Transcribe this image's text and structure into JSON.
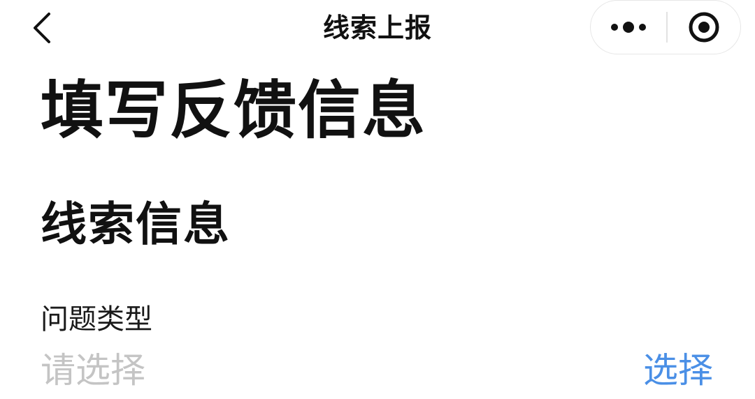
{
  "navbar": {
    "title": "线索上报",
    "back_icon": "chevron-left-icon",
    "more_icon": "more-dots-icon",
    "close_icon": "target-circle-icon"
  },
  "main": {
    "page_heading": "填写反馈信息",
    "section_heading": "线索信息",
    "problem_type": {
      "label": "问题类型",
      "placeholder": "请选择",
      "select_label": "选择"
    }
  },
  "colors": {
    "accent": "#4a8fe6",
    "placeholder": "#c4c4c4",
    "text": "#111111",
    "background": "#ffffff"
  }
}
